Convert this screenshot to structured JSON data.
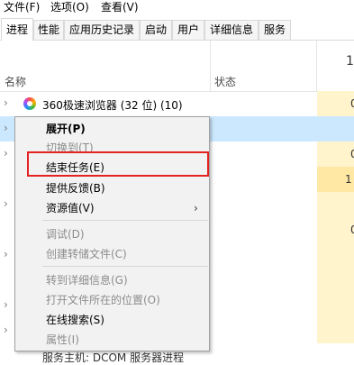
{
  "menubar": {
    "file": "文件(F)",
    "options": "选项(O)",
    "view": "查看(V)"
  },
  "tabs": [
    "进程",
    "性能",
    "应用历史记录",
    "启动",
    "用户",
    "详细信息",
    "服务"
  ],
  "header": {
    "name": "名称",
    "status": "状态",
    "cpu_partial": "1"
  },
  "rows": [
    {
      "label": "360极速浏览器 (32 位) (10)",
      "cpu": "0"
    },
    {
      "label": "",
      "cpu": ""
    },
    {
      "label": "",
      "cpu": "0"
    },
    {
      "label": "",
      "cpu": "1"
    },
    {
      "label": "",
      "cpu": ""
    },
    {
      "label": "",
      "cpu": "0"
    }
  ],
  "context_menu": {
    "items": [
      {
        "label": "展开(P)",
        "style": "bold"
      },
      {
        "label": "切换到(T)",
        "style": "disabled"
      },
      {
        "label": "结束任务(E)",
        "style": "normal"
      },
      {
        "label": "提供反馈(B)",
        "style": "normal"
      },
      {
        "label": "资源值(V)",
        "style": "submenu"
      },
      {
        "label": "调试(D)",
        "style": "disabled"
      },
      {
        "label": "创建转储文件(C)",
        "style": "disabled"
      },
      {
        "label": "转到详细信息(G)",
        "style": "disabled"
      },
      {
        "label": "打开文件所在的位置(O)",
        "style": "disabled"
      },
      {
        "label": "在线搜索(S)",
        "style": "normal"
      },
      {
        "label": "属性(I)",
        "style": "disabled"
      }
    ],
    "submenu_arrow": "›"
  },
  "bottom_partial": "服务主机: DCOM 服务器进程",
  "colors": {
    "highlight_border": "#e52222",
    "cpu_light": "#fff4cc",
    "cpu_mid": "#ffe8a3",
    "selected_row": "#cce8ff"
  }
}
